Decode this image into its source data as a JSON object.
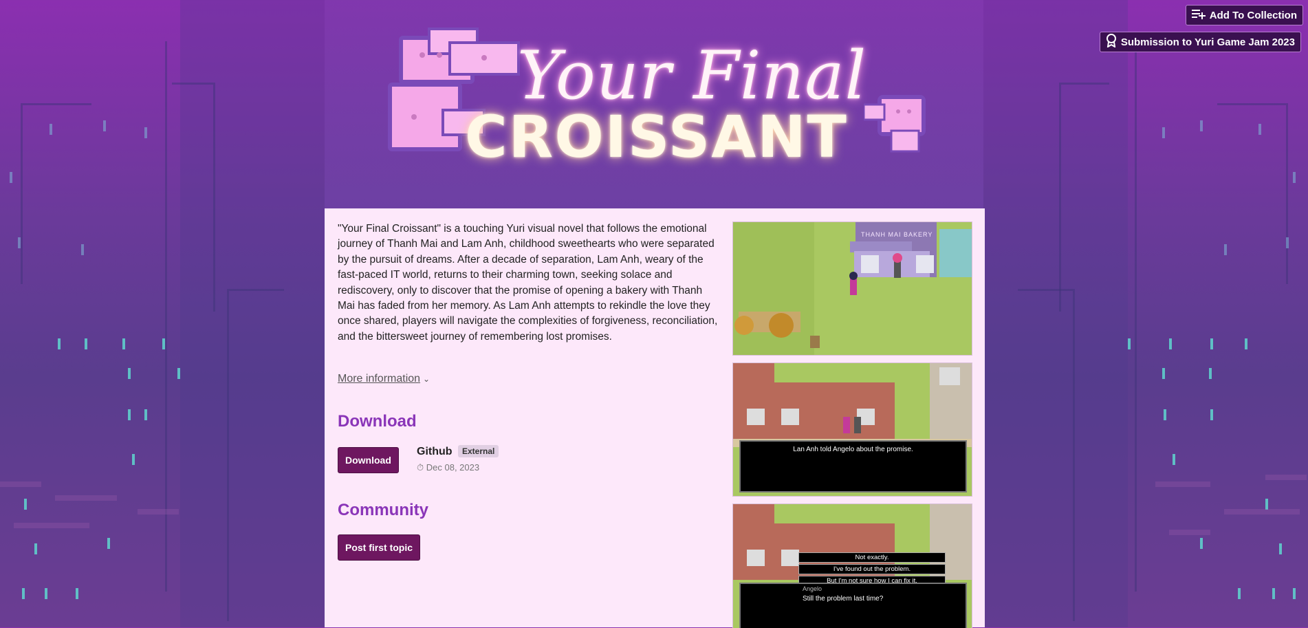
{
  "topbar": {
    "collection_label": "Add To Collection",
    "jam_label": "Submission to Yuri Game Jam 2023"
  },
  "header": {
    "title_script": "Your Final",
    "title_main": "CROISSANT"
  },
  "main": {
    "description": "\"Your Final Croissant\" is a touching Yuri visual novel that follows the emotional journey of Thanh Mai and Lam Anh, childhood sweethearts who were separated by the pursuit of dreams. After a decade of separation, Lam Anh, weary of the fast-paced IT world, returns to their charming town, seeking solace and rediscovery, only to discover that the promise of opening a bakery with Thanh Mai has faded from her memory. As Lam Anh attempts to rekindle the love they once shared, players will navigate the complexities of forgiveness, reconciliation, and the bittersweet journey of remembering lost promises.",
    "more_info": "More information",
    "download_heading": "Download",
    "download_button": "Download",
    "upload_name": "Github",
    "upload_badge": "External",
    "upload_date": "Dec 08, 2023",
    "community_heading": "Community",
    "community_button": "Post first topic"
  },
  "screenshots": {
    "shop_sign": "THANH MAI BAKERY",
    "dialog_1": "Lan Anh told Angelo about the promise.",
    "choices": [
      "Not exactly.",
      "I've found out the problem.",
      "But I'm not sure how I can fix it."
    ],
    "speaker": "Angelo",
    "dialog_2": "Still the problem last time?"
  },
  "colors": {
    "accent": "#8a35b8",
    "button": "#6e1760",
    "panel": "#fde8fa",
    "background": "#6a3a9a"
  }
}
